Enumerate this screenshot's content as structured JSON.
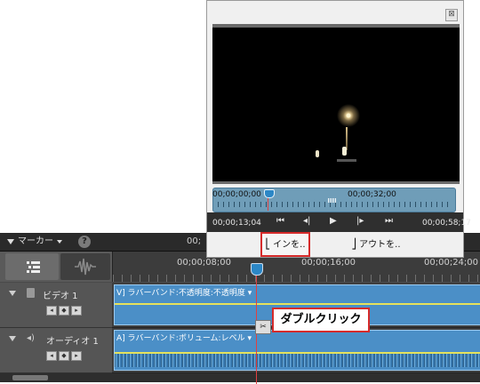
{
  "timeline": {
    "marker_label": "マーカー",
    "help_label": "?",
    "header_timecode": "00;",
    "ruler_labels": [
      "00;00;08;00",
      "00;00;16;00",
      "00;00;24;00"
    ],
    "tracks": [
      {
        "name": "ビデオ 1",
        "clip_label": "V] ラバーバンド:不透明度:不透明度 ▾"
      },
      {
        "name": "オーディオ 1",
        "clip_label": "A] ラバーバンド:ボリューム:レベル ▾"
      }
    ],
    "keyframe_nav": [
      "◂",
      "◆",
      "▸"
    ],
    "scissors_glyph": "✂"
  },
  "callout": {
    "text": "ダブルクリック"
  },
  "preview": {
    "close_glyph": "⊠",
    "timecode_start": "00;00;00;00",
    "timecode_mid": "00;00;32;00",
    "timecode_current": "00;00;13;04",
    "timecode_total": "00;00;58;17",
    "controls": [
      "⏮",
      "◂|",
      "▶",
      "|▸",
      "⏭"
    ],
    "in_button": "インを..",
    "out_button": "アウトを.."
  },
  "colors": {
    "accent": "#2c87c6",
    "highlight": "#d62b2b",
    "clip": "#4b8fc7"
  }
}
